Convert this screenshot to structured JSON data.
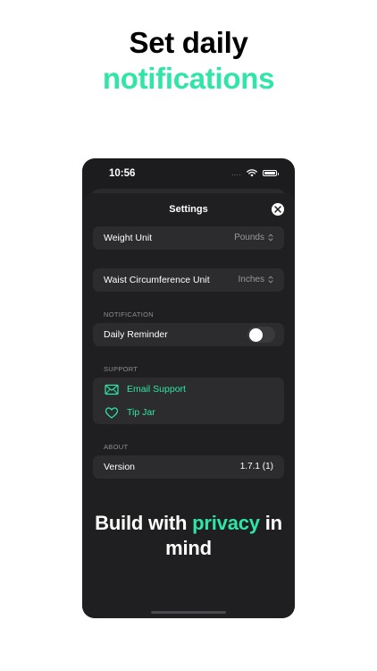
{
  "headline": {
    "line1": "Set daily",
    "line2": "notifications"
  },
  "status_bar": {
    "time": "10:56",
    "signal": "....",
    "icons": [
      "wifi-icon",
      "battery-icon"
    ]
  },
  "settings": {
    "title": "Settings",
    "close_icon": "close-icon",
    "weight_unit": {
      "label": "Weight Unit",
      "value": "Pounds"
    },
    "waist_unit": {
      "label": "Waist Circumference Unit",
      "value": "Inches"
    },
    "notification": {
      "header": "NOTIFICATION",
      "daily_reminder": {
        "label": "Daily Reminder",
        "enabled": false
      }
    },
    "support": {
      "header": "SUPPORT",
      "items": [
        {
          "label": "Email Support",
          "icon": "envelope-icon"
        },
        {
          "label": "Tip Jar",
          "icon": "heart-icon"
        }
      ]
    },
    "about": {
      "header": "ABOUT",
      "version": {
        "label": "Version",
        "value": "1.7.1 (1)"
      }
    }
  },
  "tagline": {
    "before": "Build with ",
    "accent": "privacy",
    "after": " in mind"
  },
  "colors": {
    "accent": "#2fe6a6",
    "background": "#ffffff",
    "phone_background": "#1c1c1e",
    "cell_background": "#2c2c2e"
  }
}
